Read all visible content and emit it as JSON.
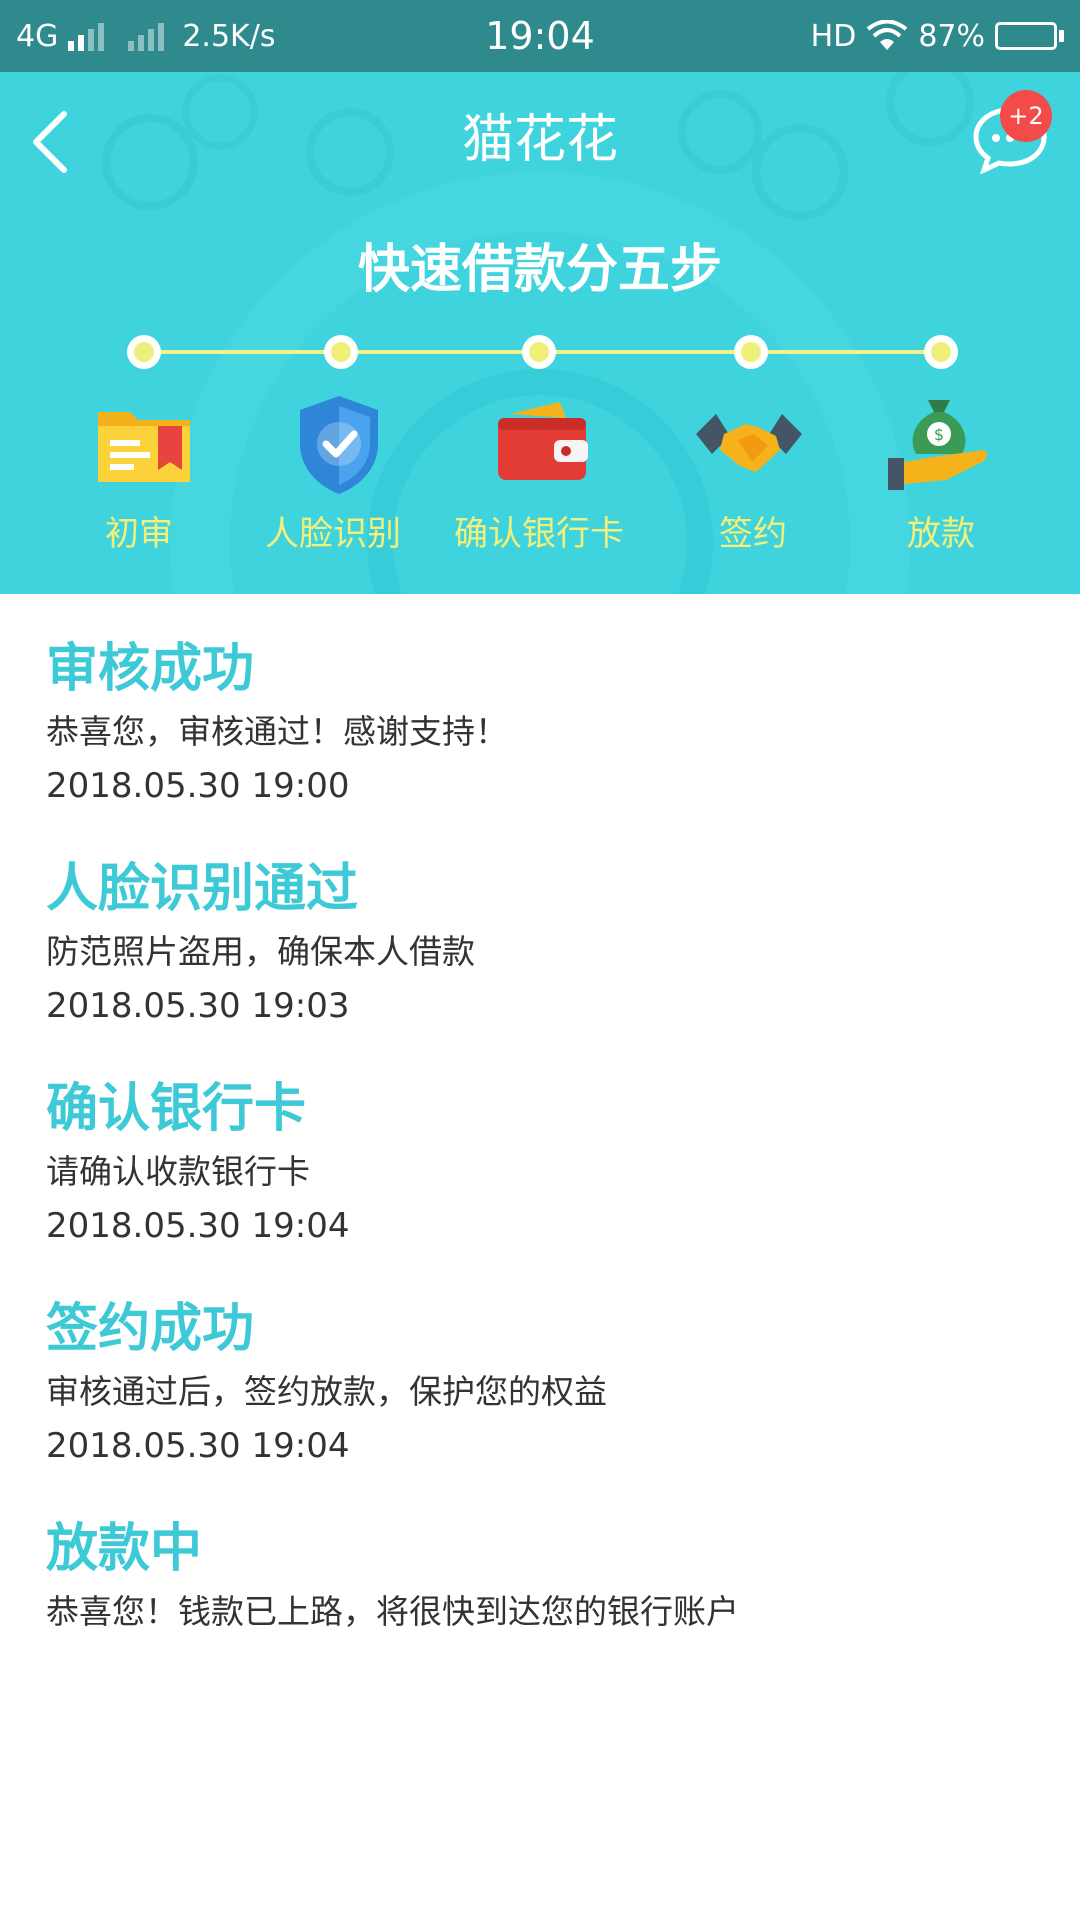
{
  "status_bar": {
    "network": "4G",
    "speed": "2.5K/s",
    "time": "19:04",
    "hd": "HD",
    "battery": "87%"
  },
  "header": {
    "title": "猫花花",
    "badge": "+2",
    "steps_title": "快速借款分五步",
    "steps": [
      {
        "label": "初审",
        "icon": "folder-icon"
      },
      {
        "label": "人脸识别",
        "icon": "shield-check-icon"
      },
      {
        "label": "确认银行卡",
        "icon": "wallet-icon"
      },
      {
        "label": "签约",
        "icon": "handshake-icon"
      },
      {
        "label": "放款",
        "icon": "money-bag-icon"
      }
    ]
  },
  "timeline": [
    {
      "title": "审核成功",
      "desc": "恭喜您，审核通过！感谢支持！",
      "time": "2018.05.30  19:00"
    },
    {
      "title": "人脸识别通过",
      "desc": "防范照片盗用，确保本人借款",
      "time": "2018.05.30  19:03"
    },
    {
      "title": "确认银行卡",
      "desc": "请确认收款银行卡",
      "time": "2018.05.30  19:04"
    },
    {
      "title": "签约成功",
      "desc": "审核通过后，签约放款，保护您的权益",
      "time": "2018.05.30  19:04"
    },
    {
      "title": "放款中",
      "desc": "恭喜您！钱款已上路，将很快到达您的银行账户",
      "time": ""
    }
  ],
  "colors": {
    "header_bg": "#3fd3dd",
    "status_bg": "#2f8a8e",
    "accent": "#3dc9d6",
    "step_label": "#f2ef7a",
    "badge": "#f34a4a"
  }
}
